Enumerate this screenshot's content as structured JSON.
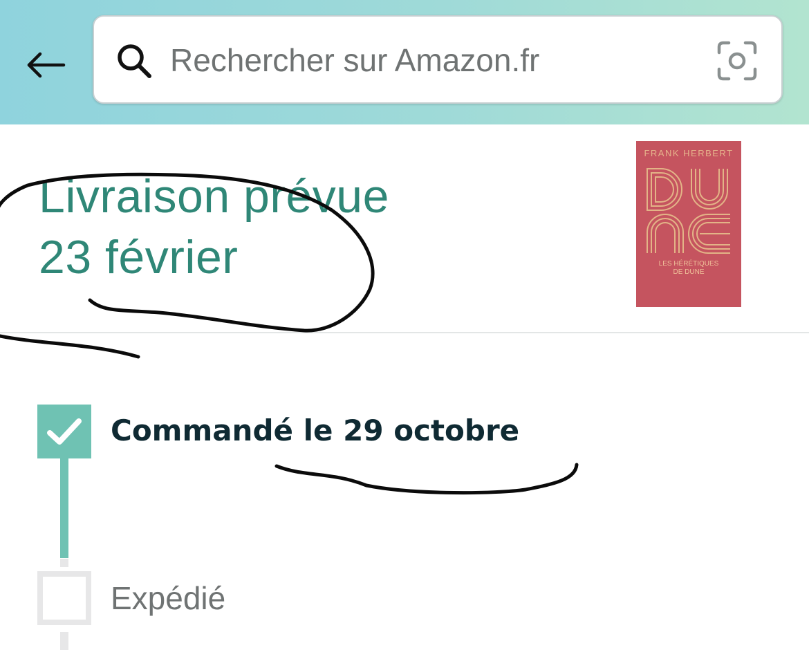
{
  "header": {
    "back_icon": "arrow-left-icon",
    "search": {
      "placeholder": "Rechercher sur Amazon.fr",
      "value": "",
      "search_icon": "search-icon",
      "camera_icon": "camera-scan-icon"
    },
    "gradient_colors": [
      "#8fd3dd",
      "#b2e4d0"
    ]
  },
  "delivery": {
    "line1": "Livraison prévue",
    "line2": "23 février",
    "color": "#2f8777"
  },
  "product": {
    "author": "FRANK HERBERT",
    "title_art": "DUNE",
    "subtitle": "LES HÉRÉTIQUES\nDE DUNE",
    "cover_color": "#c5545f"
  },
  "tracking": {
    "steps": [
      {
        "label": "Commandé le 29 octobre",
        "status": "done",
        "color": "#6fc2b3"
      },
      {
        "label": "Expédié",
        "status": "pending",
        "color": "#e7e7e8"
      }
    ]
  }
}
